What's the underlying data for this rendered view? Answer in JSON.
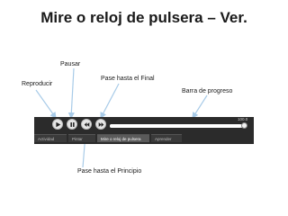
{
  "title": "Mire o reloj de pulsera – Ver.",
  "callouts": {
    "reproducir": "Reproducir",
    "pausar": "Pausar",
    "final": "Pase hasta el Final",
    "progreso": "Barra de progreso",
    "principio": "Pase hasta el Principio"
  },
  "player": {
    "time": "100.0",
    "progress": 0.96,
    "tabs": [
      {
        "label": "Actividad",
        "active": false
      },
      {
        "label": "Pintar",
        "active": false
      },
      {
        "label": "Mire o reloj de pulsera",
        "active": true
      },
      {
        "label": "Aprender",
        "active": false
      }
    ]
  },
  "colors": {
    "player_bg": "#2b2b2b",
    "button": "#e6e6e6",
    "active_tab": "#5a5a5a"
  },
  "icons": [
    "play-icon",
    "pause-icon",
    "skip-back-icon",
    "skip-forward-icon"
  ]
}
